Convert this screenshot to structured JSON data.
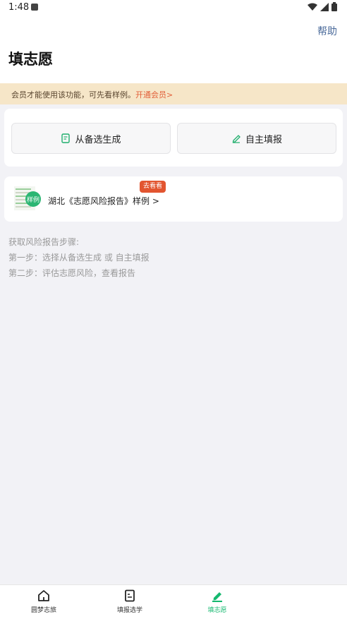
{
  "status_bar": {
    "time": "1:48"
  },
  "header": {
    "help_label": "帮助",
    "title": "填志愿"
  },
  "banner": {
    "text": "会员才能使用该功能，可先看样例。",
    "link": "开通会员>"
  },
  "actions": {
    "from_candidates": "从备选生成",
    "self_fill": "自主填报"
  },
  "sample_report": {
    "badge": "样例",
    "link_text": "湖北《志愿风险报告》样例 >",
    "tag": "去看看"
  },
  "steps": {
    "heading": "获取风险报告步骤:",
    "step1": "第一步：选择从备选生成 或 自主填报",
    "step2": "第二步：评估志愿风险，查看报告"
  },
  "bottom_nav": {
    "tab1": "圆梦志旅",
    "tab2": "填报选学",
    "tab3": "填志愿",
    "active_color": "#15b86f"
  }
}
